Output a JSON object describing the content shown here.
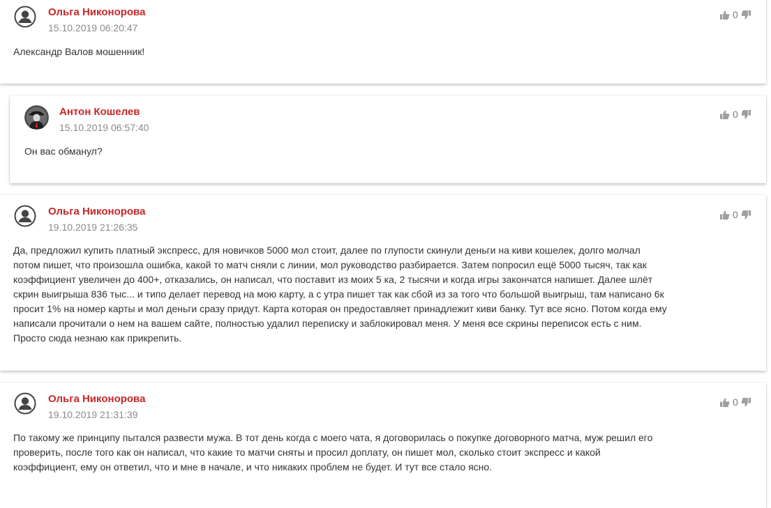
{
  "comments": [
    {
      "author": "Ольга Никонорова",
      "date": "15.10.2019 06:20:47",
      "votes": "0",
      "text": "Александр Валов мошенник!",
      "avatar": "default-user"
    },
    {
      "author": "Антон Кошелев",
      "date": "15.10.2019 06:57:40",
      "votes": "0",
      "text": "Он вас обманул?",
      "avatar": "photo-user"
    },
    {
      "author": "Ольга Никонорова",
      "date": "19.10.2019 21:26:35",
      "votes": "0",
      "text_lines": [
        "Да, предложил купить платный экспресс, для новичков 5000 мол стоит, далее по глупости скинули деньги на киви кошелек, долго молчал",
        "потом пишет, что произошла ошибка, какой то матч сняли с линии, мол руководство разбирается. Затем попросил ещё 5000 тысяч, так как",
        "коэффициент увеличен до 400+, отказались, он написал, что поставит из моих 5 ка, 2 тысячи и когда игры закончатся напишет. Далее шлёт",
        "скрин выигрыша 836 тыс... и типо делает перевод на мою карту, а с утра пишет так как сбой из за того что большой выигрыш, там написано 6к",
        "просит 1% на номер карты и мол деньги сразу придут. Карта которая он предоставляет принадлежит киви банку. Тут все ясно. Потом когда ему",
        "написали прочитали о нем на вашем сайте, полностью удалил переписку и заблокировал меня. У меня все скрины переписок есть с ним.",
        "Просто сюда незнаю как прикрепить."
      ],
      "avatar": "default-user"
    },
    {
      "author": "Ольга Никонорова",
      "date": "19.10.2019 21:31:39",
      "votes": "0",
      "text_lines": [
        "По такому же принципу пытался развести мужа. В тот день когда с моего чата, я договорилась о покупке договорного матча, муж решил его",
        "проверить, после того как он написал, что какие то матчи сняты и просил доплату, он пишет мол, сколько стоит экспресс и какой",
        "коэффициент, ему он ответил, что и мне в начале, и что никаких проблем не будет. И тут все стало ясно."
      ],
      "avatar": "default-user"
    }
  ],
  "colors": {
    "author": "#c62828",
    "date": "#8a8a8a",
    "text": "#333333",
    "icon": "#9e9e9e"
  }
}
